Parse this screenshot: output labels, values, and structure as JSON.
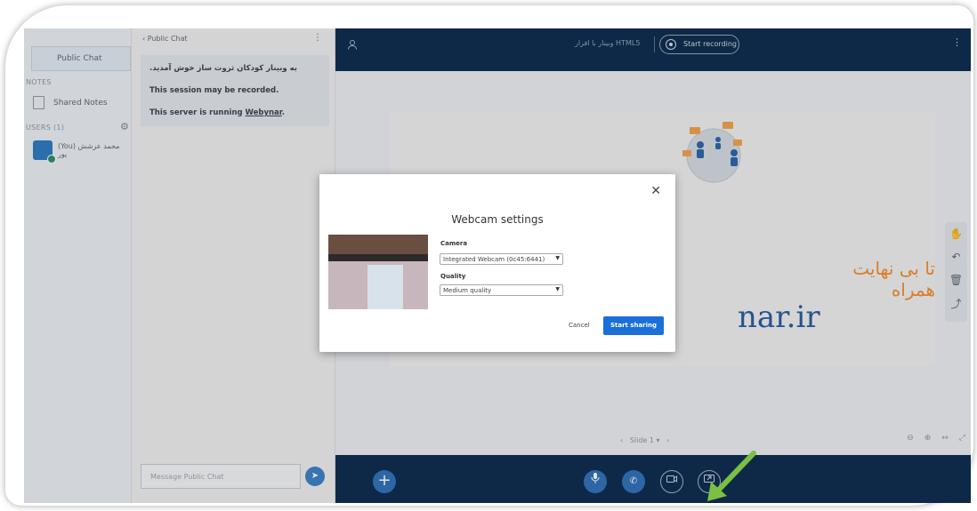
{
  "users_panel": {
    "public_chat_label": "Public Chat",
    "notes_heading": "NOTES",
    "shared_notes_label": "Shared Notes",
    "users_heading": "USERS (1)",
    "user_name": "(You) محمد عرشش پور"
  },
  "chat": {
    "header_label": "Public Chat",
    "welcome_message": "به وبینار کودکان ثروت ساز خوش آمدید.",
    "recorded_message": "This session may be recorded.",
    "server_prefix": "This server is running ",
    "server_link": "Webynar",
    "server_suffix": ".",
    "input_placeholder": "Message Public Chat"
  },
  "topbar": {
    "title": "وبینار با افزار HTML5",
    "record_label": "Start recording"
  },
  "slide": {
    "persian_text": "تا بی نهایت همراه",
    "url_text": "nar.ir",
    "nav_label": "Slide 1"
  },
  "webcam_modal": {
    "title": "Webcam settings",
    "camera_label": "Camera",
    "camera_value": "Integrated Webcam (0c45:6441)",
    "quality_label": "Quality",
    "quality_value": "Medium quality",
    "cancel_label": "Cancel",
    "start_label": "Start sharing"
  },
  "colors": {
    "topbar_bg": "#0b2a4a",
    "accent_blue": "#1a6fd8",
    "annotation_arrow": "#79c043",
    "slide_orange": "#ef8a2a"
  }
}
